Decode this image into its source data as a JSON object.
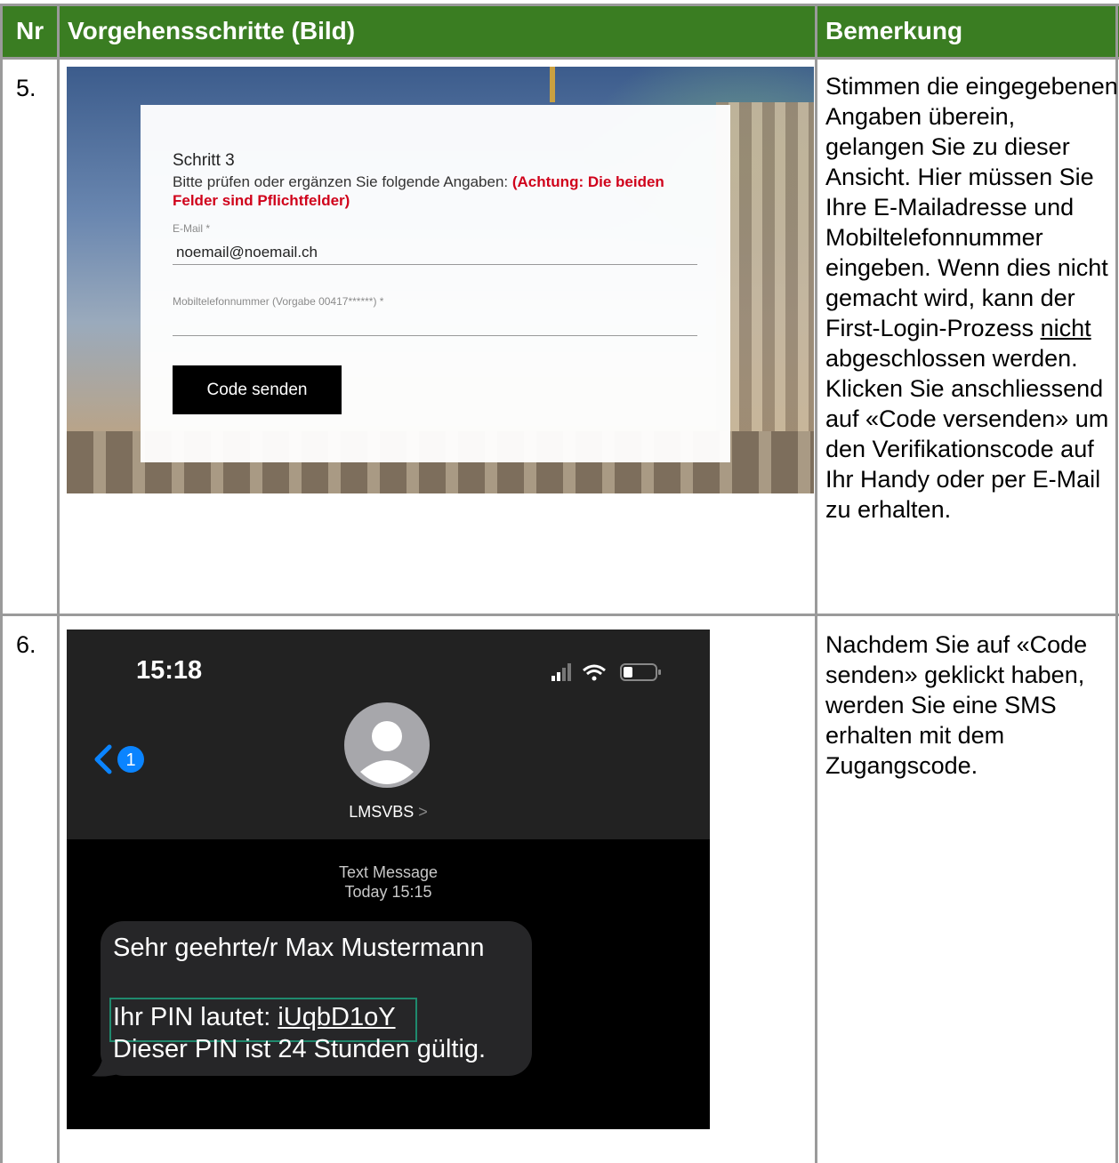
{
  "table": {
    "headers": {
      "nr": "Nr",
      "steps": "Vorgehensschritte (Bild)",
      "remark": "Bemerkung"
    },
    "rows": [
      {
        "nr": "5.",
        "remark_before": "Stimmen die eingegebenen Angaben überein, gelangen Sie zu dieser Ansicht. Hier müssen Sie Ihre E-Mailadresse und Mobiltelefonnummer eingeben. Wenn dies nicht gemacht wird, kann der First-Login-Prozess ",
        "remark_underlined": "nicht",
        "remark_after": " abgeschlossen werden. Klicken Sie anschliessend auf «Code versenden» um den Verifikationscode auf Ihr Handy oder per E-Mail zu erhalten."
      },
      {
        "nr": "6.",
        "remark": "Nachdem Sie auf «Code senden» geklickt haben, werden Sie eine SMS erhalten mit dem Zugangscode."
      }
    ]
  },
  "form": {
    "title": "Schritt 3",
    "description": "Bitte prüfen oder ergänzen Sie folgende Angaben: ",
    "warning": "(Achtung: Die beiden Felder sind Pflichtfelder)",
    "email_label": "E-Mail *",
    "email_value": "noemail@noemail.ch",
    "mobile_label": "Mobiltelefonnummer (Vorgabe 00417******) *",
    "mobile_value": "",
    "button_label": "Code senden"
  },
  "phone": {
    "time": "15:18",
    "back_badge": "1",
    "contact_name": "LMSVBS",
    "contact_chevron": ">",
    "meta_line1": "Text Message",
    "meta_line2": "Today 15:15",
    "msg_line1": "Sehr geehrte/r Max Mustermann",
    "msg_pin_prefix": "Ihr PIN lautet: ",
    "msg_pin_value": "iUqbD1oY",
    "msg_line3": "Dieser PIN ist 24 Stunden gültig."
  },
  "colors": {
    "header_green": "#3a7d22",
    "warning_red": "#d0021b",
    "ios_blue": "#0a84ff"
  }
}
